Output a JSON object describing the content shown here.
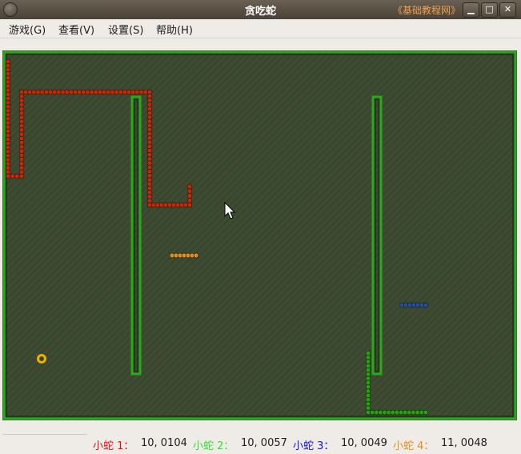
{
  "window": {
    "title": "贪吃蛇",
    "brand": "《基础教程网》",
    "buttons": {
      "minimize": "▁",
      "maximize": "□",
      "close": "✕"
    }
  },
  "menu": [
    {
      "label": "游戏(G)"
    },
    {
      "label": "查看(V)"
    },
    {
      "label": "设置(S)"
    },
    {
      "label": "帮助(H)"
    }
  ],
  "board": {
    "background": "#3c4a31",
    "wall_color": "#2aa81c",
    "food_color": "#f0b000",
    "snakes": [
      {
        "color": "#c82808"
      },
      {
        "color": "#28a014"
      },
      {
        "color": "#2050a0"
      },
      {
        "color": "#e09018"
      }
    ]
  },
  "status": [
    {
      "name": "小蛇 1：",
      "value": "10, 0104",
      "color": "#e01010"
    },
    {
      "name": "小蛇 2：",
      "value": "10, 0057",
      "color": "#30e030"
    },
    {
      "name": "小蛇 3：",
      "value": "10, 0049",
      "color": "#1010e0"
    },
    {
      "name": "小蛇 4：",
      "value": "11, 0048",
      "color": "#e09020"
    }
  ]
}
